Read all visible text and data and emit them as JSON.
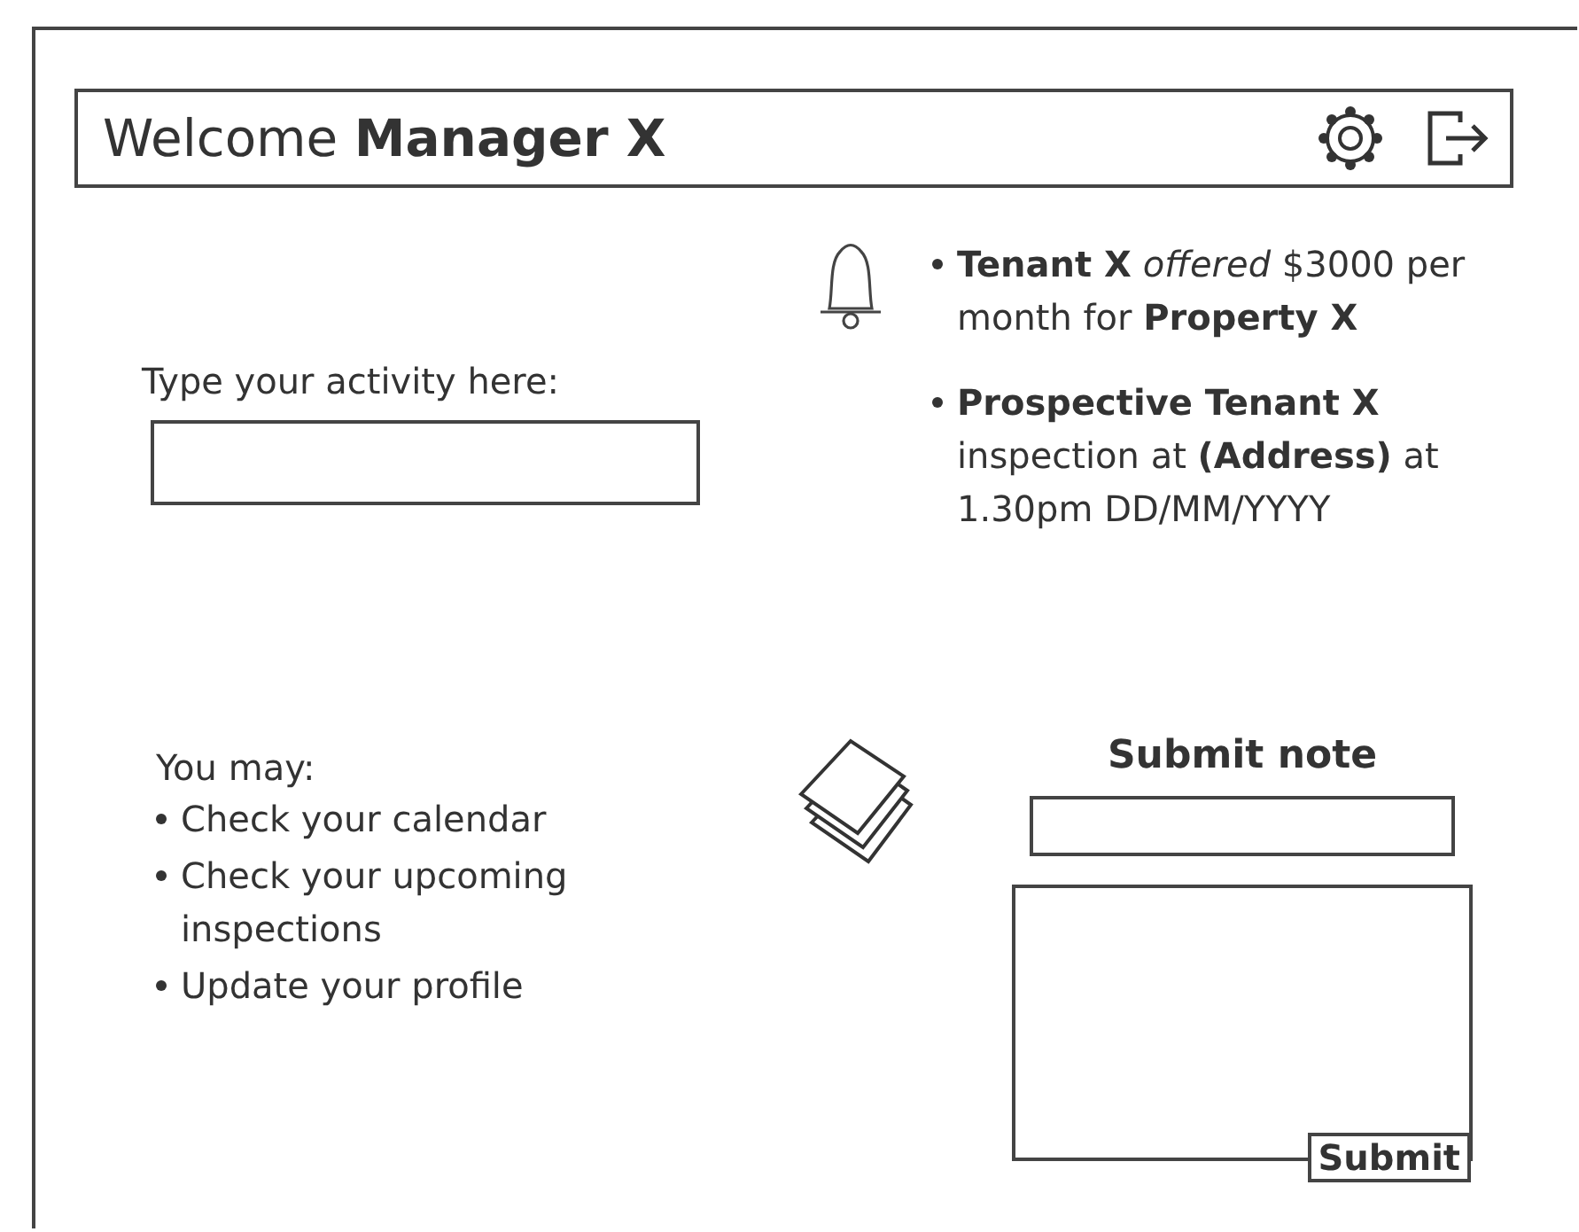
{
  "header": {
    "title": "Welcome **Manager X**"
  },
  "activity": {
    "label": "Type your activity here:"
  },
  "notifications": [
    {
      "text": "**Tenant X** *offered* $3000 per month for **Property X**"
    },
    {
      "text": "**Prospective Tenant X** inspection at **(Address)** at 1.30pm DD/MM/YYYY"
    }
  ],
  "suggestions": {
    "heading": "You may:",
    "items": [
      "Check your calendar",
      "Check your upcoming inspections",
      "Update your profile"
    ]
  },
  "note": {
    "title": "Submit note",
    "button": "Submit"
  }
}
